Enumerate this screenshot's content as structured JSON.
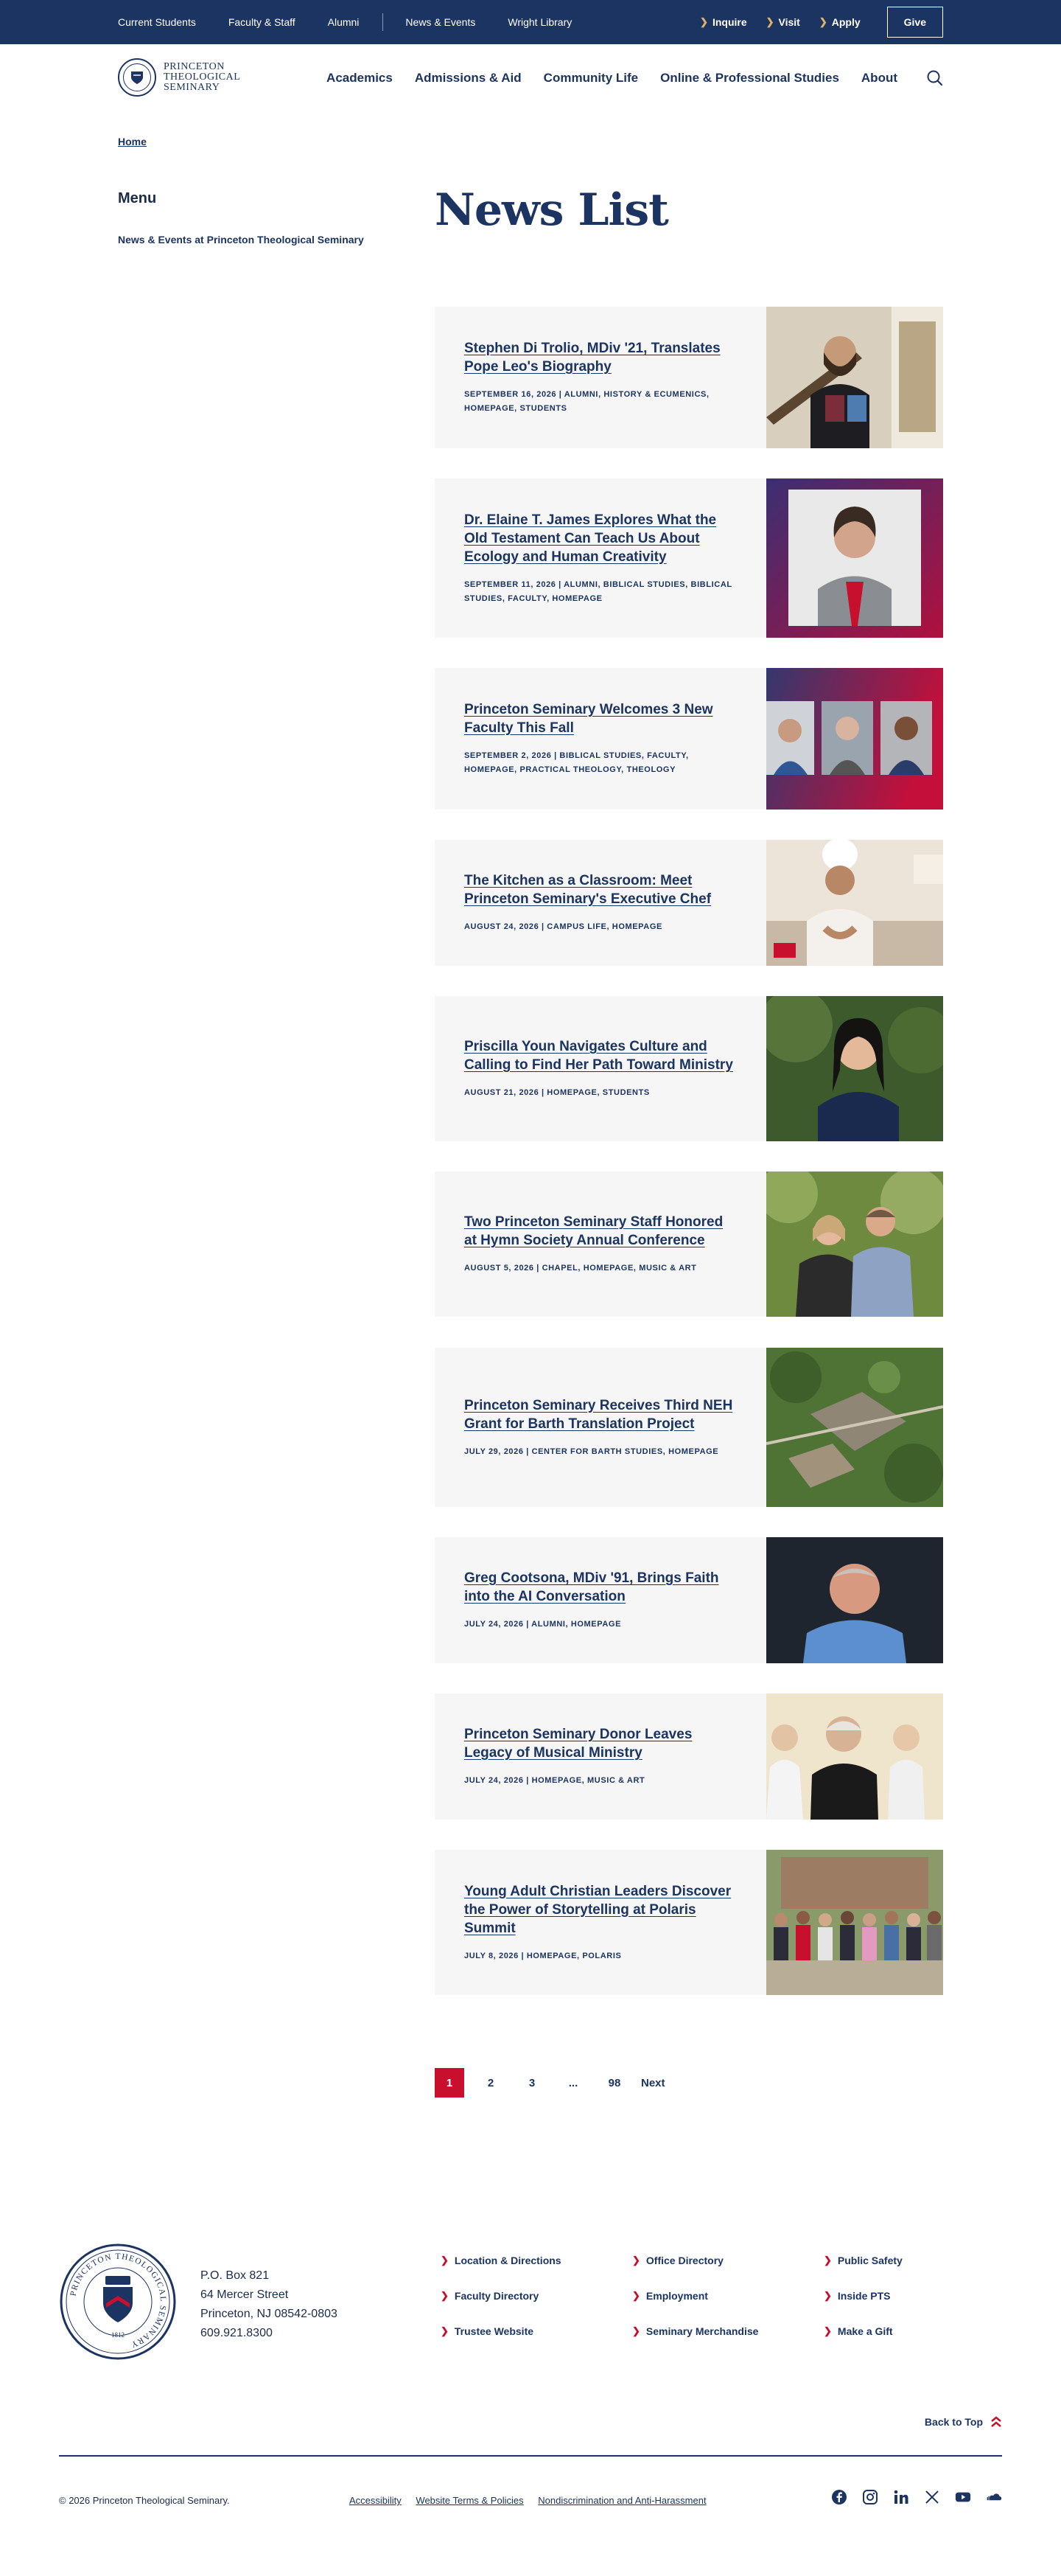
{
  "utility_bar": {
    "links": [
      "Current Students",
      "Faculty & Staff",
      "Alumni",
      "News & Events",
      "Wright Library"
    ],
    "quick_links": [
      "Inquire",
      "Visit",
      "Apply"
    ],
    "give_label": "Give"
  },
  "header": {
    "logo_text": [
      "PRINCETON",
      "THEOLOGICAL",
      "SEMINARY"
    ],
    "nav": [
      "Academics",
      "Admissions & Aid",
      "Community Life",
      "Online & Professional Studies",
      "About"
    ]
  },
  "breadcrumb": {
    "home": "Home"
  },
  "sidebar": {
    "title": "Menu",
    "link": "News & Events at Princeton Theological Seminary"
  },
  "page_title": "News List",
  "news": [
    {
      "title": "Stephen Di Trolio, MDiv '21, Translates Pope Leo's Biography",
      "meta": "September 16, 2026 | Alumni, History & Ecumenics, Homepage, Students"
    },
    {
      "title": "Dr. Elaine T. James Explores What the Old Testament Can Teach Us About Ecology and Human Creativity",
      "meta": "September 11, 2026 | Alumni, Biblical Studies, Biblical Studies, Faculty, Homepage"
    },
    {
      "title": "Princeton Seminary Welcomes 3 New Faculty This Fall",
      "meta": "September 2, 2026 | Biblical Studies, Faculty, Homepage, Practical Theology, Theology"
    },
    {
      "title": "The Kitchen as a Classroom: Meet Princeton Seminary's Executive Chef",
      "meta": "August 24, 2026 | Campus Life, Homepage"
    },
    {
      "title": "Priscilla Youn Navigates Culture and Calling to Find Her Path Toward Ministry",
      "meta": "August 21, 2026 | Homepage, Students"
    },
    {
      "title": "Two Princeton Seminary Staff Honored at Hymn Society Annual Conference",
      "meta": "August 5, 2026 | Chapel, Homepage, Music & Art"
    },
    {
      "title": "Princeton Seminary Receives Third NEH Grant for Barth Translation Project",
      "meta": "July 29, 2026 | Center for Barth Studies, Homepage"
    },
    {
      "title": "Greg Cootsona, MDiv '91, Brings Faith into the AI Conversation",
      "meta": "July 24, 2026 | Alumni, Homepage"
    },
    {
      "title": "Princeton Seminary Donor Leaves Legacy of Musical Ministry",
      "meta": "July 24, 2026 | Homepage, Music & Art"
    },
    {
      "title": "Young Adult Christian Leaders Discover the Power of Storytelling at Polaris Summit",
      "meta": "July 8, 2026 | Homepage, Polaris"
    }
  ],
  "pagination": {
    "pages": [
      "1",
      "2",
      "3",
      "...",
      "98"
    ],
    "current": "1",
    "next": "Next"
  },
  "footer": {
    "seal_text": "PRINCETON THEOLOGICAL SEMINARY",
    "seal_year": "1812",
    "address": [
      "P.O. Box 821",
      "64 Mercer Street",
      "Princeton, NJ 08542-0803",
      "609.921.8300"
    ],
    "links": [
      "Location & Directions",
      "Office Directory",
      "Public Safety",
      "Faculty Directory",
      "Employment",
      "Inside PTS",
      "Trustee Website",
      "Seminary Merchandise",
      "Make a Gift"
    ],
    "back_to_top": "Back to Top",
    "copyright": "© 2026 Princeton Theological Seminary.",
    "legal": [
      "Accessibility",
      "Website Terms & Policies",
      "Nondiscrimination and Anti-Harassment"
    ],
    "social": [
      "facebook-icon",
      "instagram-icon",
      "linkedin-icon",
      "x-icon",
      "youtube-icon",
      "soundcloud-icon"
    ]
  },
  "colors": {
    "navy": "#1c3461",
    "red": "#c8102e",
    "card": "#f6f6f6"
  }
}
